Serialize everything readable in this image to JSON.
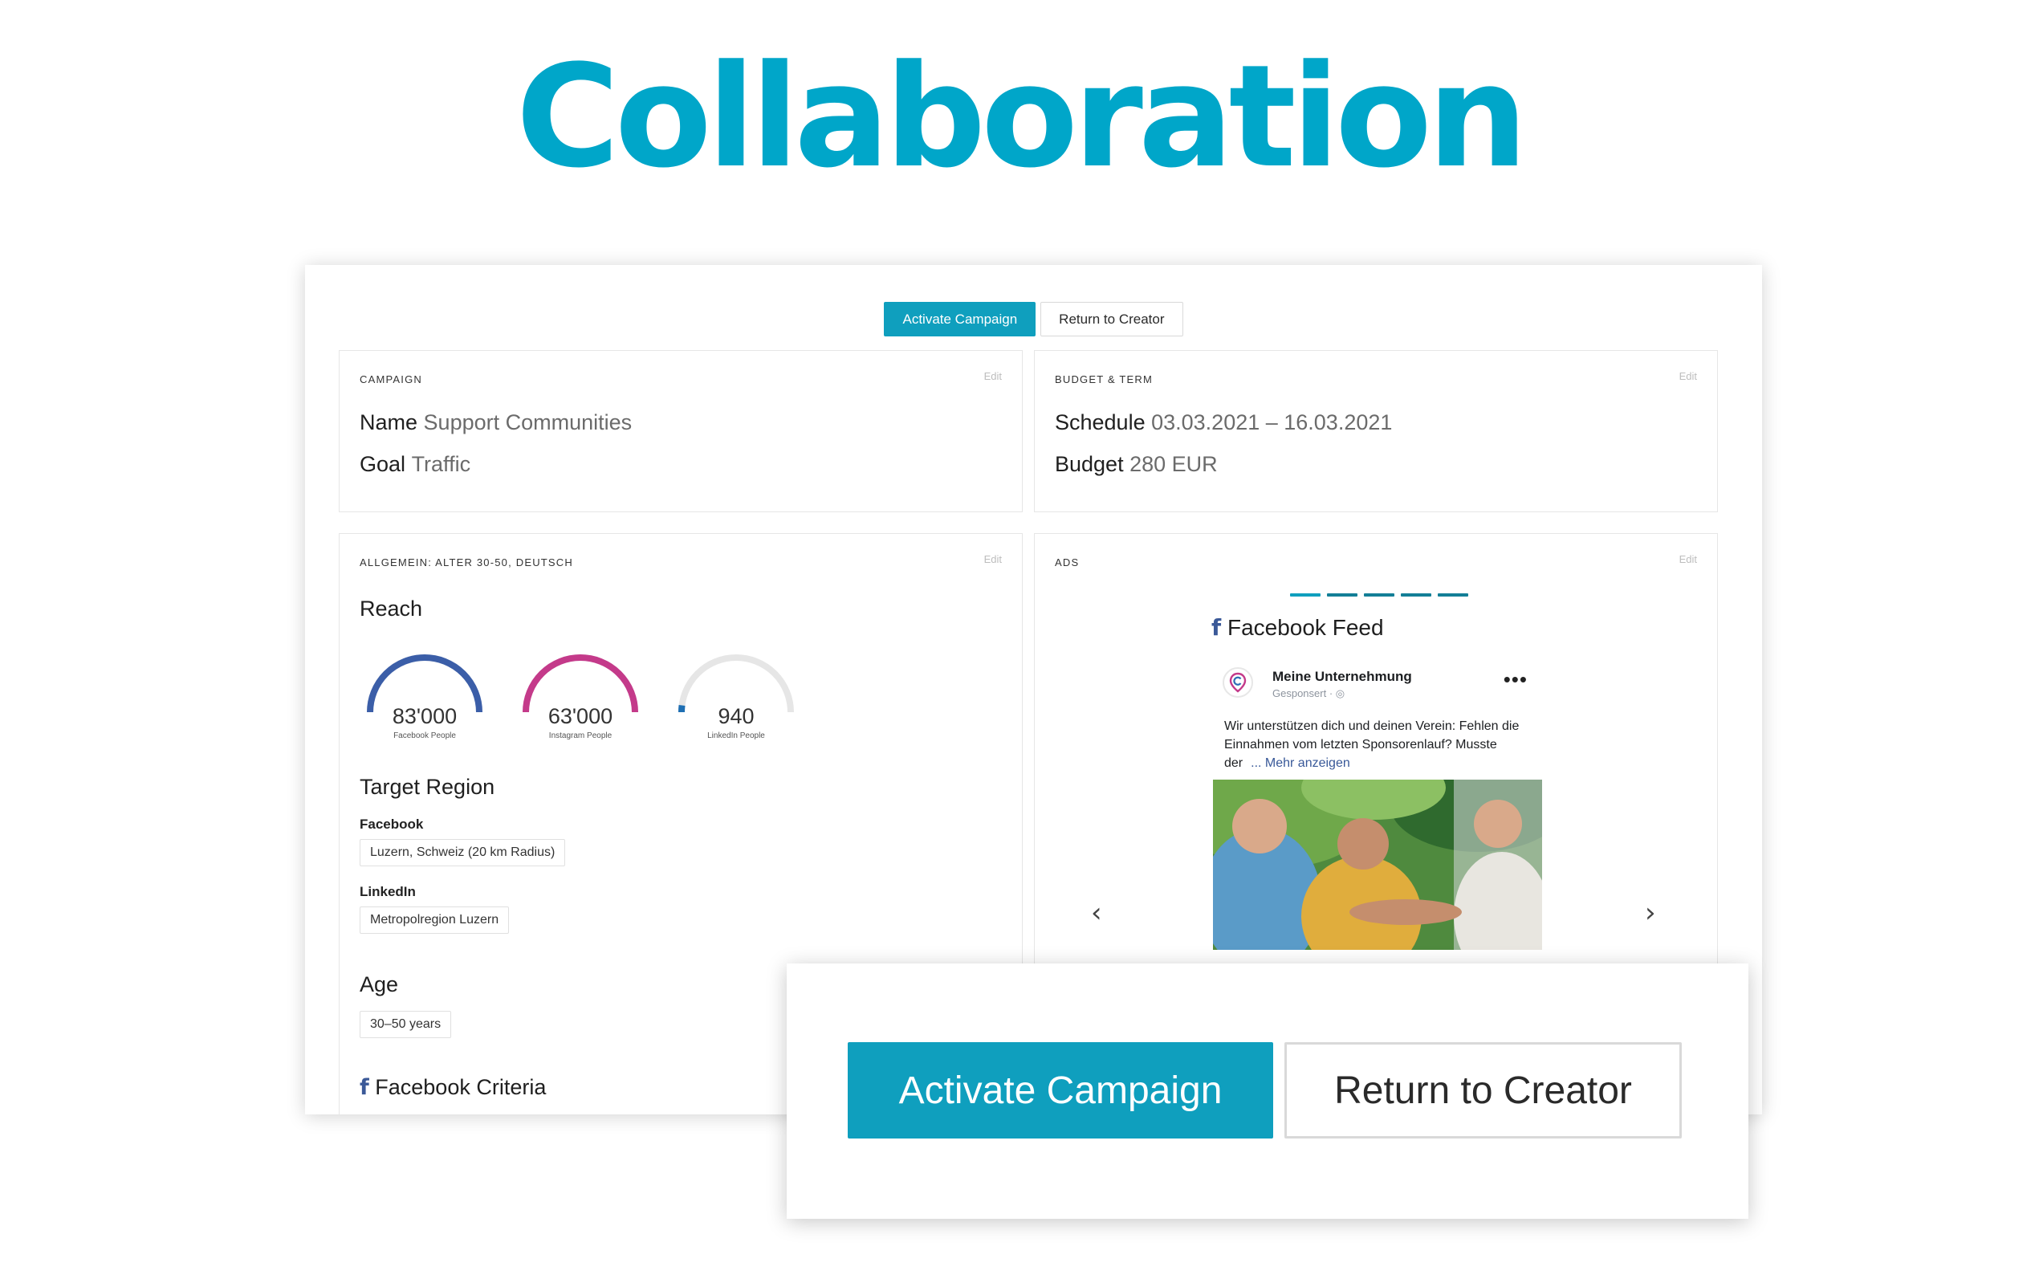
{
  "hero": {
    "title": "Collaboration"
  },
  "top_actions": {
    "activate": "Activate Campaign",
    "return": "Return to Creator"
  },
  "campaign_card": {
    "label": "CAMPAIGN",
    "edit": "Edit",
    "name_key": "Name",
    "name_value": "Support Communities",
    "goal_key": "Goal",
    "goal_value": "Traffic"
  },
  "budget_card": {
    "label": "BUDGET & TERM",
    "edit": "Edit",
    "schedule_key": "Schedule",
    "schedule_value": "03.03.2021 – 16.03.2021",
    "budget_key": "Budget",
    "budget_value": "280 EUR"
  },
  "audience_card": {
    "label": "ALLGEMEIN: ALTER 30-50, DEUTSCH",
    "edit": "Edit",
    "reach_title": "Reach",
    "reach": [
      {
        "value": "83'000",
        "label": "Facebook People",
        "color": "#3b5ea8",
        "fill": 1.0
      },
      {
        "value": "63'000",
        "label": "Instagram People",
        "color": "#c43a8a",
        "fill": 1.0
      },
      {
        "value": "940",
        "label": "LinkedIn People",
        "color": "#1f6fb3",
        "fill": 0.04
      }
    ],
    "target_region_title": "Target Region",
    "facebook_label": "Facebook",
    "facebook_region": "Luzern, Schweiz (20 km Radius)",
    "linkedin_label": "LinkedIn",
    "linkedin_region": "Metropolregion Luzern",
    "age_title": "Age",
    "age_value": "30–50 years",
    "fb_criteria_title": "Facebook Criteria"
  },
  "ads_card": {
    "label": "ADS",
    "edit": "Edit",
    "placement": "Facebook Feed",
    "post": {
      "page_name": "Meine Unternehmung",
      "sponsored": "Gesponsert · ",
      "more": "•••",
      "text": "Wir unterstützen dich und deinen Verein: Fehlen die Einnahmen vom letzten Sponsorenlauf? Musste der",
      "more_link": "... Mehr anzeigen"
    },
    "prev_icon": "chevron-left-icon",
    "next_icon": "chevron-right-icon"
  },
  "overlay": {
    "activate": "Activate Campaign",
    "return": "Return to Creator"
  }
}
